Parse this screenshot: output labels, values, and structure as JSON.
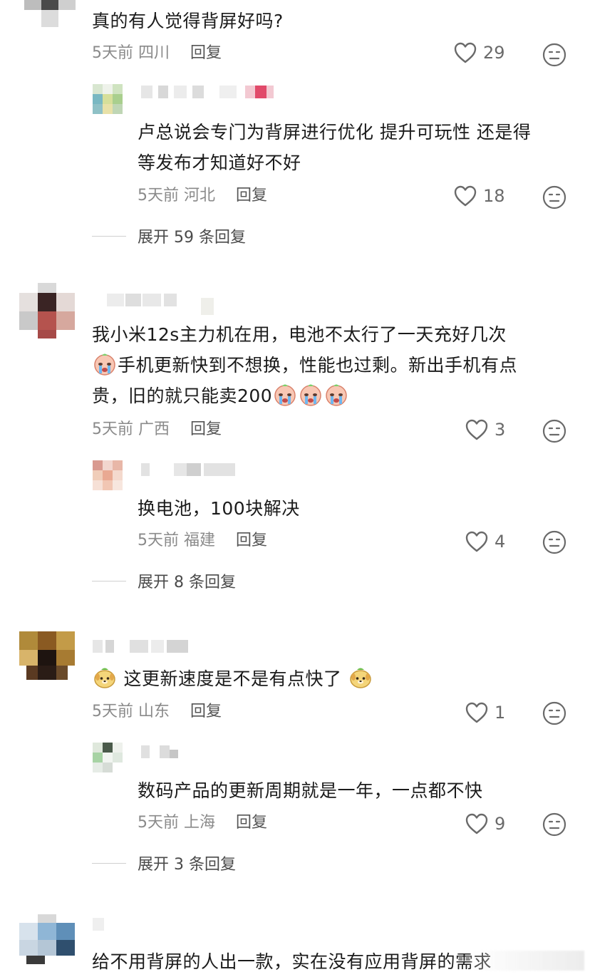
{
  "comments": [
    {
      "text": "真的有人觉得背屏好吗?",
      "time": "5天前",
      "location": "四川",
      "reply_label": "回复",
      "likes": "29",
      "replies": [
        {
          "text_line1": "卢总说会专门为背屏进行优化 提升可玩性 还是得",
          "text_line2": "等发布才知道好不好",
          "time": "5天前",
          "location": "河北",
          "reply_label": "回复",
          "likes": "18"
        }
      ],
      "expand_label": "展开 59 条回复"
    },
    {
      "text_line1": "我小米12s主力机在用，电池不太行了一天充好几次",
      "text_line2": "手机更新快到不想换，性能也过剩。新出手机有点",
      "text_line3": "贵，旧的就只能卖200",
      "time": "5天前",
      "location": "广西",
      "reply_label": "回复",
      "likes": "3",
      "replies": [
        {
          "text": "换电池，100块解决",
          "time": "5天前",
          "location": "福建",
          "reply_label": "回复",
          "likes": "4"
        }
      ],
      "expand_label": "展开 8 条回复"
    },
    {
      "text": "这更新速度是不是有点快了",
      "time": "5天前",
      "location": "山东",
      "reply_label": "回复",
      "likes": "1",
      "replies": [
        {
          "text": "数码产品的更新周期就是一年，一点都不快",
          "time": "5天前",
          "location": "上海",
          "reply_label": "回复",
          "likes": "9"
        }
      ],
      "expand_label": "展开 3 条回复"
    },
    {
      "text": "给不用背屏的人出一款，实在没有应用背屏的需求"
    }
  ],
  "icons": {
    "like": "heart-outline-icon",
    "dislike": "neutral-face-icon",
    "crying_emoji": "crying-face-emoji",
    "dog_emoji": "dog-face-emoji"
  },
  "colors": {
    "text": "#1b1b1b",
    "meta": "#8a8a8a",
    "icon": "#6a6a6a"
  }
}
